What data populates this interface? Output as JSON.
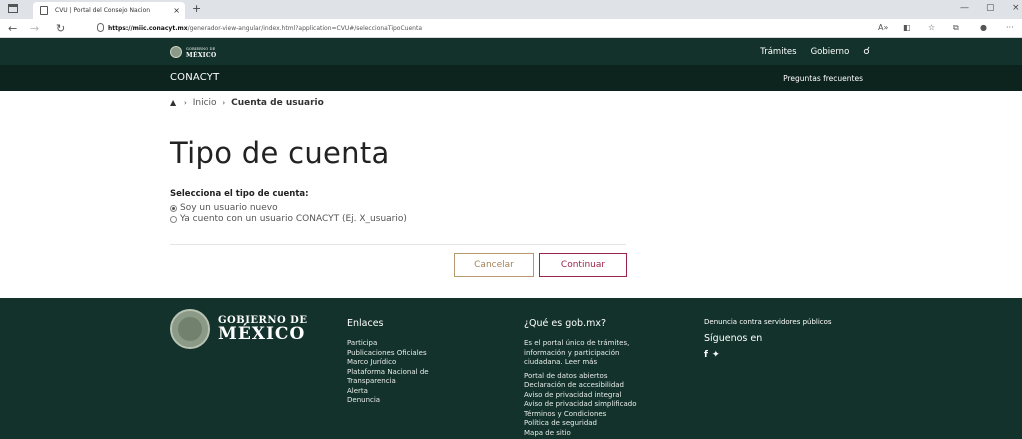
{
  "browser": {
    "tab_title": "CVU | Portal del Consejo Nacion",
    "url_host": "https://miic.conacyt.mx",
    "url_path": "/generador-view-angular/index.html?application=CVU#/seleccionaTipoCuenta"
  },
  "gov_header": {
    "logo_small": "GOBIERNO DE",
    "logo_big": "MÉXICO",
    "nav": [
      "Trámites",
      "Gobierno"
    ]
  },
  "sub_header": {
    "brand": "CONACYT",
    "faq": "Preguntas frecuentes"
  },
  "breadcrumb": {
    "home": "Inicio",
    "current": "Cuenta de usuario"
  },
  "page": {
    "title": "Tipo de cuenta",
    "question": "Selecciona el tipo de cuenta:",
    "options": [
      {
        "label": "Soy un usuario nuevo",
        "selected": true
      },
      {
        "label": "Ya cuento con un usuario CONACYT (Ej. X_usuario)",
        "selected": false
      }
    ],
    "cancel": "Cancelar",
    "continue": "Continuar"
  },
  "footer": {
    "logo_small": "GOBIERNO DE",
    "logo_big": "MÉXICO",
    "links_heading": "Enlaces",
    "links": [
      "Participa",
      "Publicaciones Oficiales",
      "Marco Jurídico",
      "Plataforma Nacional de",
      "Transparencia",
      "Alerta",
      "Denuncia"
    ],
    "about_heading": "¿Qué es gob.mx?",
    "about_text": [
      "Es el portal único de trámites,",
      "información y participación",
      "ciudadana. Leer más"
    ],
    "about_links": [
      "Portal de datos abiertos",
      "Declaración de accesibilidad",
      "Aviso de privacidad integral",
      "Aviso de privacidad simplificado",
      "Términos y Condiciones",
      "Política de seguridad",
      "Mapa de sitio"
    ],
    "complaint": "Denuncia contra servidores públicos",
    "follow": "Síguenos en"
  },
  "colors": {
    "gov_green": "#13322b",
    "gov_green_dark": "#0c231e",
    "accent_red": "#9d2449",
    "accent_gold": "#b69a6e"
  }
}
